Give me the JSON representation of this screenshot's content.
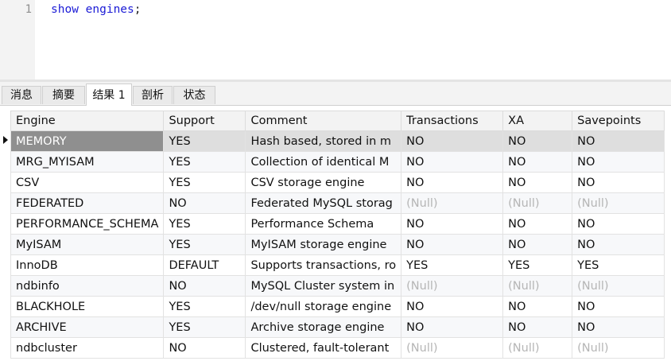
{
  "editor": {
    "line_number": "1",
    "code_keywords": "show engines",
    "code_terminator": ";"
  },
  "tabs": [
    {
      "label": "消息"
    },
    {
      "label": "摘要"
    },
    {
      "label": "结果 1"
    },
    {
      "label": "剖析"
    },
    {
      "label": "状态"
    }
  ],
  "active_tab": "结果 1",
  "result": {
    "columns": [
      "Engine",
      "Support",
      "Comment",
      "Transactions",
      "XA",
      "Savepoints"
    ],
    "rows": [
      {
        "engine": "MEMORY",
        "support": "YES",
        "comment": "Hash based, stored in m",
        "transactions": "NO",
        "xa": "NO",
        "savepoints": "NO"
      },
      {
        "engine": "MRG_MYISAM",
        "support": "YES",
        "comment": "Collection of identical M",
        "transactions": "NO",
        "xa": "NO",
        "savepoints": "NO"
      },
      {
        "engine": "CSV",
        "support": "YES",
        "comment": "CSV storage engine",
        "transactions": "NO",
        "xa": "NO",
        "savepoints": "NO"
      },
      {
        "engine": "FEDERATED",
        "support": "NO",
        "comment": "Federated MySQL storag",
        "transactions": "(Null)",
        "xa": "(Null)",
        "savepoints": "(Null)"
      },
      {
        "engine": "PERFORMANCE_SCHEMA",
        "support": "YES",
        "comment": "Performance Schema",
        "transactions": "NO",
        "xa": "NO",
        "savepoints": "NO"
      },
      {
        "engine": "MyISAM",
        "support": "YES",
        "comment": "MyISAM storage engine",
        "transactions": "NO",
        "xa": "NO",
        "savepoints": "NO"
      },
      {
        "engine": "InnoDB",
        "support": "DEFAULT",
        "comment": "Supports transactions, ro",
        "transactions": "YES",
        "xa": "YES",
        "savepoints": "YES"
      },
      {
        "engine": "ndbinfo",
        "support": "NO",
        "comment": "MySQL Cluster system in",
        "transactions": "(Null)",
        "xa": "(Null)",
        "savepoints": "(Null)"
      },
      {
        "engine": "BLACKHOLE",
        "support": "YES",
        "comment": "/dev/null storage engine",
        "transactions": "NO",
        "xa": "NO",
        "savepoints": "NO"
      },
      {
        "engine": "ARCHIVE",
        "support": "YES",
        "comment": "Archive storage engine",
        "transactions": "NO",
        "xa": "NO",
        "savepoints": "NO"
      },
      {
        "engine": "ndbcluster",
        "support": "NO",
        "comment": "Clustered, fault-tolerant",
        "transactions": "(Null)",
        "xa": "(Null)",
        "savepoints": "(Null)"
      }
    ]
  },
  "current_row_index": 0,
  "icons": {
    "row_pointer": "current-row-pointer-icon"
  }
}
